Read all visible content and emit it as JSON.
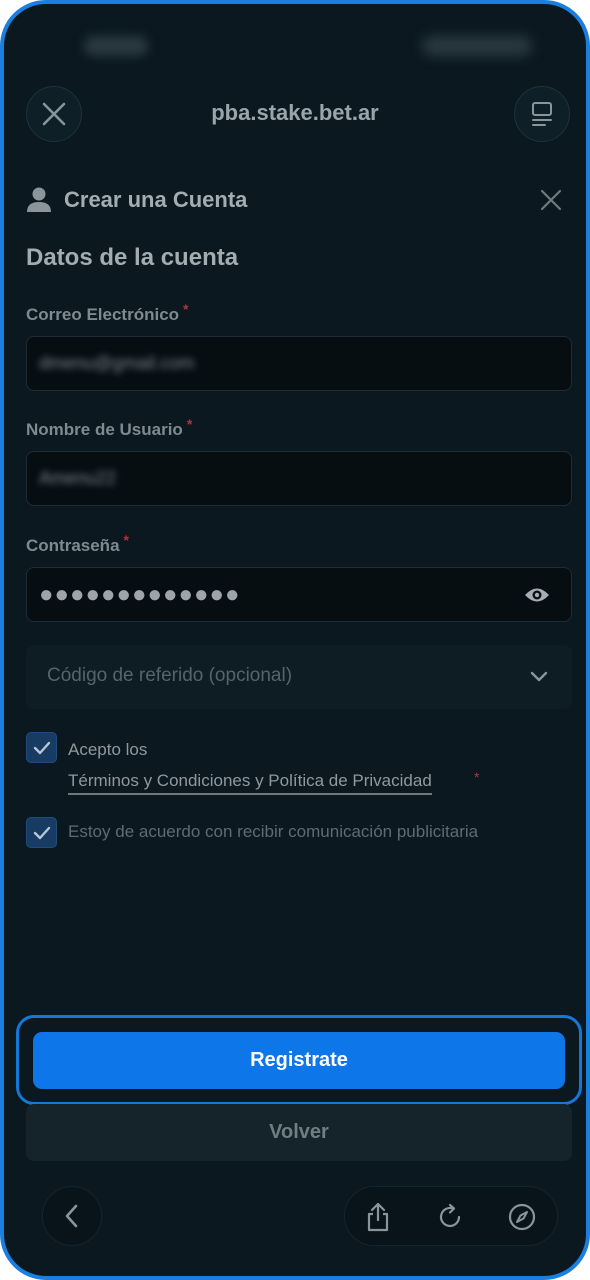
{
  "browser": {
    "url": "pba.stake.bet.ar",
    "close_icon": "close-icon",
    "tabs_icon": "tabs-icon"
  },
  "modal": {
    "title": "Crear una Cuenta",
    "section_title": "Datos de la cuenta"
  },
  "form": {
    "email_label": "Correo Electrónico",
    "email_value": "dmenu@gmail.com",
    "username_label": "Nombre de Usuario",
    "username_value": "Amenu22",
    "password_label": "Contraseña",
    "password_value": "●●●●●●●●●●●●●",
    "required_mark": "*",
    "referral_placeholder": "Código de referido (opcional)",
    "terms_prefix": "Acepto los",
    "terms_link": "Términos y Condiciones y Política de Privacidad",
    "terms_checked": true,
    "consent_text": "Estoy de acuerdo con recibir comunicación publicitaria",
    "consent_checked": true
  },
  "actions": {
    "register": "Registrate",
    "back": "Volver"
  },
  "colors": {
    "primary": "#0d76e8",
    "background": "#0b1820",
    "required": "#b5323a"
  }
}
